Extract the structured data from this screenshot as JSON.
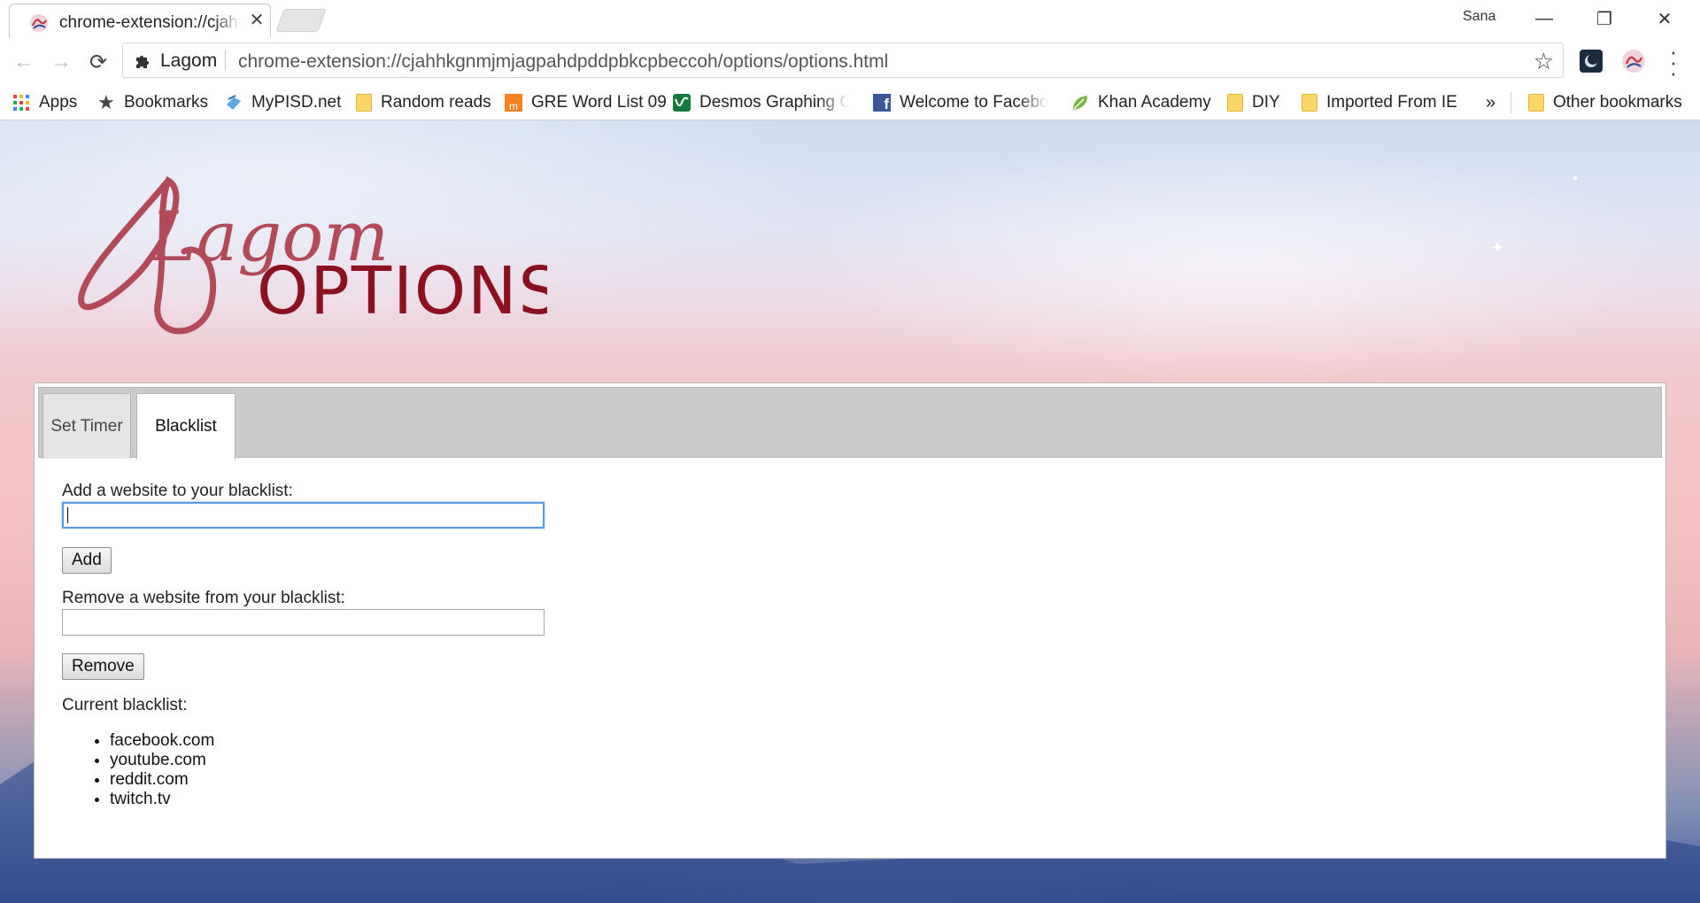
{
  "browser": {
    "tab_title": "chrome-extension://cjahhkgnmjmjagpahdpddpbkcpbeccoh/options/options.html",
    "profile_name": "Sana",
    "site_chip": "Lagom",
    "url": "chrome-extension://cjahhkgnmjmjagpahdpddpbkcpbeccoh/options/options.html",
    "window_controls": {
      "minimize": "—",
      "restore": "❐",
      "close": "✕"
    }
  },
  "bookmarks": {
    "items": [
      {
        "label": "Apps",
        "icon": "apps-grid-icon"
      },
      {
        "label": "Bookmarks",
        "icon": "star-icon"
      },
      {
        "label": "MyPISD.net",
        "icon": "mypisd-icon"
      },
      {
        "label": "Random reads",
        "icon": "folder-icon"
      },
      {
        "label": "GRE Word List 09",
        "icon": "gre-icon"
      },
      {
        "label": "Desmos Graphing Calculator",
        "icon": "desmos-icon"
      },
      {
        "label": "Welcome to Facebook",
        "icon": "facebook-icon"
      },
      {
        "label": "Khan Academy",
        "icon": "khan-academy-icon"
      },
      {
        "label": "DIY",
        "icon": "folder-icon"
      },
      {
        "label": "Imported From IE",
        "icon": "folder-icon"
      }
    ],
    "overflow": "»",
    "other": "Other bookmarks"
  },
  "header": {
    "logo_script": "Lagom",
    "logo_word": "OPTIONS",
    "logo_color": "#b34a5a",
    "logo_word_color": "#8b1020"
  },
  "options": {
    "tabs": [
      {
        "label": "Set Timer",
        "active": false
      },
      {
        "label": "Blacklist",
        "active": true
      }
    ],
    "add_label": "Add a website to your blacklist:",
    "add_value": "",
    "add_button": "Add",
    "remove_label": "Remove a website from your blacklist:",
    "remove_value": "",
    "remove_button": "Remove",
    "current_label": "Current blacklist:",
    "blacklist": [
      "facebook.com",
      "youtube.com",
      "reddit.com",
      "twitch.tv"
    ]
  }
}
